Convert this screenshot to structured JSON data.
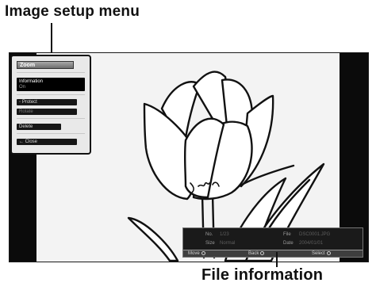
{
  "callouts": {
    "image_setup_menu": "Image setup menu",
    "file_information": "File information"
  },
  "menu": {
    "title": "Zoom",
    "items": [
      {
        "label": "Information",
        "sub": "On",
        "selected": true
      },
      {
        "label": "Protect",
        "icon": "protect-icon"
      },
      {
        "label": "Rotate",
        "dim": true
      },
      {
        "label": "Delete"
      },
      {
        "label": "Close",
        "icon": "back-arrow-icon"
      }
    ]
  },
  "file_info": {
    "row1": {
      "left_label": "No.",
      "left_value": "1/23",
      "right_label": "File",
      "right_value": "DSC0001.JPG"
    },
    "row2": {
      "left_label": "Size",
      "left_value": "Normal",
      "right_label": "Date",
      "right_value": "2004/01/01"
    },
    "controls": [
      {
        "label": "Move",
        "icon": "button-circle-icon"
      },
      {
        "label": "Back",
        "icon": "button-circle-icon"
      },
      {
        "label": "Select",
        "icon": "button-circle-icon"
      }
    ]
  },
  "colors": {
    "screen_bg": "#f3f3f3",
    "pillar": "#0b0b0b",
    "menu_bg": "#e9e9e9",
    "menu_item_bg": "#161616",
    "info_bg": "#1a1a1a"
  }
}
